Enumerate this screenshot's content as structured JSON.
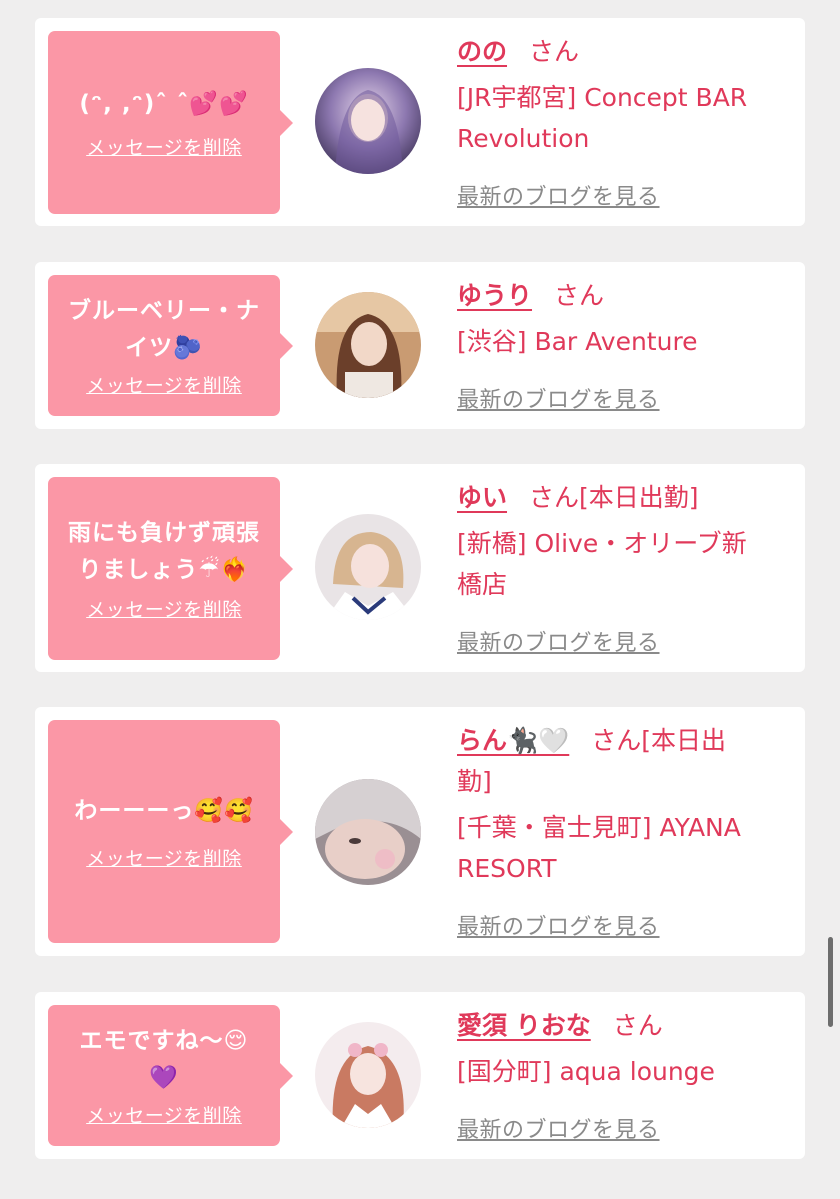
{
  "delete_label": "メッセージを削除",
  "blog_label": "最新のブログを見る",
  "accent_color": "#e0395a",
  "bubble_color": "#fb97a6",
  "entries": [
    {
      "message": "(ᵔ, ,ᵔ)ˆ ˆ💕💕",
      "name": "のの",
      "suffix": "さん",
      "shop_lines": [
        "[JR宇都宮] Concept BAR",
        "Revolution"
      ]
    },
    {
      "message_lines": [
        "ブルーベリー・ナ",
        "イツ🫐"
      ],
      "name": "ゆうり",
      "suffix": "さん",
      "shop_lines": [
        "[渋谷] Bar Aventure"
      ]
    },
    {
      "message_lines": [
        "雨にも負けず頑張",
        "りましょう☔❤️‍🔥"
      ],
      "name": "ゆい",
      "suffix": "さん[本日出勤]",
      "shop_lines": [
        "[新橋] Olive・オリーブ新",
        "橋店"
      ]
    },
    {
      "message": "わーーーっ🥰🥰",
      "name": "らん🐈‍⬛🤍",
      "suffix_lines": [
        "さん[本日出",
        "勤]"
      ],
      "shop_lines": [
        "[千葉・富士見町] AYANA",
        "RESORT"
      ]
    },
    {
      "message_lines": [
        "エモですね〜😌",
        "💜"
      ],
      "name": "愛須 りおな",
      "suffix": "さん",
      "shop_lines": [
        "[国分町] aqua lounge"
      ]
    }
  ]
}
